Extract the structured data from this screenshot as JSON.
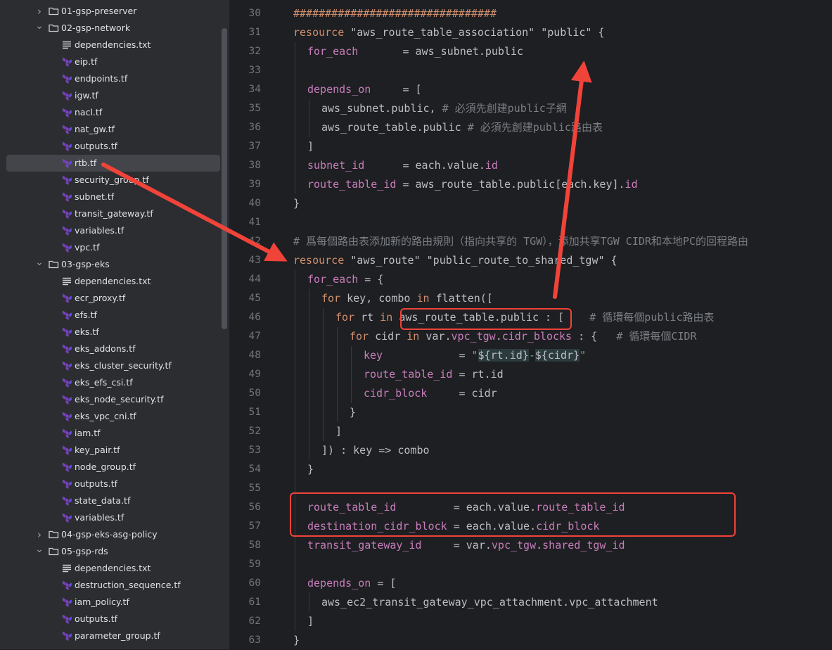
{
  "sidebar": {
    "items": [
      {
        "type": "folder",
        "label": "01-gsp-preserver",
        "expanded": false
      },
      {
        "type": "folder",
        "label": "02-gsp-network",
        "expanded": true
      },
      {
        "type": "txt",
        "label": "dependencies.txt"
      },
      {
        "type": "tf",
        "label": "eip.tf"
      },
      {
        "type": "tf",
        "label": "endpoints.tf"
      },
      {
        "type": "tf",
        "label": "igw.tf"
      },
      {
        "type": "tf",
        "label": "nacl.tf"
      },
      {
        "type": "tf",
        "label": "nat_gw.tf"
      },
      {
        "type": "tf",
        "label": "outputs.tf"
      },
      {
        "type": "tf",
        "label": "rtb.tf",
        "selected": true
      },
      {
        "type": "tf",
        "label": "security_group.tf"
      },
      {
        "type": "tf",
        "label": "subnet.tf"
      },
      {
        "type": "tf",
        "label": "transit_gateway.tf"
      },
      {
        "type": "tf",
        "label": "variables.tf"
      },
      {
        "type": "tf",
        "label": "vpc.tf"
      },
      {
        "type": "folder",
        "label": "03-gsp-eks",
        "expanded": true
      },
      {
        "type": "txt",
        "label": "dependencies.txt"
      },
      {
        "type": "tf",
        "label": "ecr_proxy.tf"
      },
      {
        "type": "tf",
        "label": "efs.tf"
      },
      {
        "type": "tf",
        "label": "eks.tf"
      },
      {
        "type": "tf",
        "label": "eks_addons.tf"
      },
      {
        "type": "tf",
        "label": "eks_cluster_security.tf"
      },
      {
        "type": "tf",
        "label": "eks_efs_csi.tf"
      },
      {
        "type": "tf",
        "label": "eks_node_security.tf"
      },
      {
        "type": "tf",
        "label": "eks_vpc_cni.tf"
      },
      {
        "type": "tf",
        "label": "iam.tf"
      },
      {
        "type": "tf",
        "label": "key_pair.tf"
      },
      {
        "type": "tf",
        "label": "node_group.tf"
      },
      {
        "type": "tf",
        "label": "outputs.tf"
      },
      {
        "type": "tf",
        "label": "state_data.tf"
      },
      {
        "type": "tf",
        "label": "variables.tf"
      },
      {
        "type": "folder",
        "label": "04-gsp-eks-asg-policy",
        "expanded": false
      },
      {
        "type": "folder",
        "label": "05-gsp-rds",
        "expanded": true
      },
      {
        "type": "txt",
        "label": "dependencies.txt"
      },
      {
        "type": "tf",
        "label": "destruction_sequence.tf"
      },
      {
        "type": "tf",
        "label": "iam_policy.tf"
      },
      {
        "type": "tf",
        "label": "outputs.tf"
      },
      {
        "type": "tf",
        "label": "parameter_group.tf"
      }
    ]
  },
  "editor": {
    "lines": [
      {
        "n": "30",
        "indent": 0,
        "tokens": [
          {
            "t": "################################",
            "c": "kw"
          }
        ]
      },
      {
        "n": "31",
        "indent": 0,
        "tokens": [
          {
            "t": "resource ",
            "c": "kw"
          },
          {
            "t": "\"aws_route_table_association\" \"public\" {",
            "c": ""
          }
        ]
      },
      {
        "n": "32",
        "indent": 1,
        "tokens": [
          {
            "t": "for_each",
            "c": "prop"
          },
          {
            "t": "       = aws_subnet.public",
            "c": ""
          }
        ]
      },
      {
        "n": "33",
        "indent": 0,
        "tokens": []
      },
      {
        "n": "34",
        "indent": 1,
        "tokens": [
          {
            "t": "depends_on",
            "c": "prop"
          },
          {
            "t": "     = [",
            "c": ""
          }
        ]
      },
      {
        "n": "35",
        "indent": 2,
        "tokens": [
          {
            "t": "aws_subnet.public, ",
            "c": ""
          },
          {
            "t": "# 必須先創建public子網",
            "c": "cmt"
          }
        ]
      },
      {
        "n": "36",
        "indent": 2,
        "tokens": [
          {
            "t": "aws_route_table.public ",
            "c": ""
          },
          {
            "t": "# 必須先創建public路由表",
            "c": "cmt"
          }
        ]
      },
      {
        "n": "37",
        "indent": 1,
        "tokens": [
          {
            "t": "]",
            "c": ""
          }
        ]
      },
      {
        "n": "38",
        "indent": 1,
        "tokens": [
          {
            "t": "subnet_id",
            "c": "prop"
          },
          {
            "t": "      = each.value.",
            "c": ""
          },
          {
            "t": "id",
            "c": "prop"
          }
        ]
      },
      {
        "n": "39",
        "indent": 1,
        "tokens": [
          {
            "t": "route_table_id",
            "c": "prop"
          },
          {
            "t": " = aws_route_table.public[each.key].",
            "c": ""
          },
          {
            "t": "id",
            "c": "prop"
          }
        ]
      },
      {
        "n": "40",
        "indent": 0,
        "tokens": [
          {
            "t": "}",
            "c": ""
          }
        ]
      },
      {
        "n": "41",
        "indent": 0,
        "tokens": []
      },
      {
        "n": "42",
        "indent": 0,
        "tokens": [
          {
            "t": "# 爲每個路由表添加新的路由規則（指向共享的 TGW），添加共享TGW CIDR和本地PC的回程路由",
            "c": "cmt"
          }
        ]
      },
      {
        "n": "43",
        "indent": 0,
        "tokens": [
          {
            "t": "resource ",
            "c": "kw"
          },
          {
            "t": "\"aws_route\" \"public_route_to_shared_tgw\" {",
            "c": ""
          }
        ]
      },
      {
        "n": "44",
        "indent": 1,
        "tokens": [
          {
            "t": "for_each",
            "c": "prop"
          },
          {
            "t": " = {",
            "c": ""
          }
        ]
      },
      {
        "n": "45",
        "indent": 2,
        "tokens": [
          {
            "t": "for ",
            "c": "kw"
          },
          {
            "t": "key, combo ",
            "c": ""
          },
          {
            "t": "in ",
            "c": "kw"
          },
          {
            "t": "flatten([",
            "c": ""
          }
        ]
      },
      {
        "n": "46",
        "indent": 3,
        "tokens": [
          {
            "t": "for ",
            "c": "kw"
          },
          {
            "t": "rt ",
            "c": ""
          },
          {
            "t": "in ",
            "c": "kw"
          },
          {
            "t": "aws_route_table.public : [    ",
            "c": ""
          },
          {
            "t": "# 循環每個public路由表",
            "c": "cmt"
          }
        ]
      },
      {
        "n": "47",
        "indent": 4,
        "tokens": [
          {
            "t": "for ",
            "c": "kw"
          },
          {
            "t": "cidr ",
            "c": ""
          },
          {
            "t": "in ",
            "c": "kw"
          },
          {
            "t": "var.",
            "c": ""
          },
          {
            "t": "vpc_tgw",
            "c": "prop"
          },
          {
            "t": ".",
            "c": ""
          },
          {
            "t": "cidr_blocks",
            "c": "prop"
          },
          {
            "t": " : {   ",
            "c": ""
          },
          {
            "t": "# 循環每個CIDR",
            "c": "cmt"
          }
        ]
      },
      {
        "n": "48",
        "indent": 5,
        "tokens": [
          {
            "t": "key",
            "c": "prop"
          },
          {
            "t": "            = ",
            "c": ""
          },
          {
            "t": "\"",
            "c": "str"
          },
          {
            "t": "${rt.id}",
            "c": "interp"
          },
          {
            "t": "-",
            "c": "str"
          },
          {
            "t": "${cidr}",
            "c": "interp"
          },
          {
            "t": "\"",
            "c": "str"
          }
        ]
      },
      {
        "n": "49",
        "indent": 5,
        "tokens": [
          {
            "t": "route_table_id",
            "c": "prop"
          },
          {
            "t": " = rt.id",
            "c": ""
          }
        ]
      },
      {
        "n": "50",
        "indent": 5,
        "tokens": [
          {
            "t": "cidr_block",
            "c": "prop"
          },
          {
            "t": "     = cidr",
            "c": ""
          }
        ]
      },
      {
        "n": "51",
        "indent": 4,
        "tokens": [
          {
            "t": "}",
            "c": ""
          }
        ]
      },
      {
        "n": "52",
        "indent": 3,
        "tokens": [
          {
            "t": "]",
            "c": ""
          }
        ]
      },
      {
        "n": "53",
        "indent": 2,
        "tokens": [
          {
            "t": "]) : key => combo",
            "c": ""
          }
        ]
      },
      {
        "n": "54",
        "indent": 1,
        "tokens": [
          {
            "t": "}",
            "c": ""
          }
        ]
      },
      {
        "n": "55",
        "indent": 0,
        "tokens": []
      },
      {
        "n": "56",
        "indent": 1,
        "tokens": [
          {
            "t": "route_table_id",
            "c": "prop"
          },
          {
            "t": "         = each.value.",
            "c": ""
          },
          {
            "t": "route_table_id",
            "c": "prop"
          }
        ]
      },
      {
        "n": "57",
        "indent": 1,
        "tokens": [
          {
            "t": "destination_cidr_block",
            "c": "prop"
          },
          {
            "t": " = each.value.",
            "c": ""
          },
          {
            "t": "cidr_block",
            "c": "prop"
          }
        ]
      },
      {
        "n": "58",
        "indent": 1,
        "tokens": [
          {
            "t": "transit_gateway_id",
            "c": "prop"
          },
          {
            "t": "     = var.",
            "c": ""
          },
          {
            "t": "vpc_tgw",
            "c": "prop"
          },
          {
            "t": ".",
            "c": ""
          },
          {
            "t": "shared_tgw_id",
            "c": "prop"
          }
        ]
      },
      {
        "n": "59",
        "indent": 0,
        "tokens": []
      },
      {
        "n": "60",
        "indent": 1,
        "tokens": [
          {
            "t": "depends_on",
            "c": "prop"
          },
          {
            "t": " = [",
            "c": ""
          }
        ]
      },
      {
        "n": "61",
        "indent": 2,
        "tokens": [
          {
            "t": "aws_ec2_transit_gateway_vpc_attachment.vpc_attachment",
            "c": ""
          }
        ]
      },
      {
        "n": "62",
        "indent": 1,
        "tokens": [
          {
            "t": "]",
            "c": ""
          }
        ]
      },
      {
        "n": "63",
        "indent": 0,
        "tokens": [
          {
            "t": "}",
            "c": ""
          }
        ]
      }
    ]
  },
  "colors": {
    "annotation_red": "#f0433a",
    "terraform_icon": "#7b42bc"
  },
  "icons": {
    "folder": "folder-icon",
    "terraform_file": "terraform-file-icon",
    "text_file": "text-file-icon",
    "chevron_right": "chevron-right-icon",
    "chevron_down": "chevron-down-icon"
  }
}
